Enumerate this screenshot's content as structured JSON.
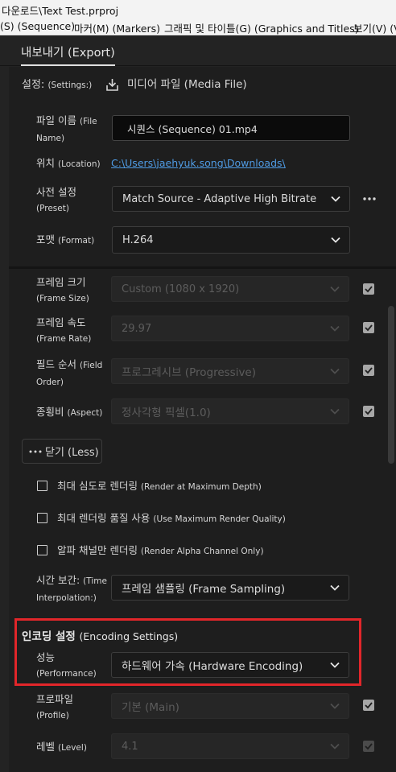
{
  "window": {
    "title": "다운로드\\Text Test.prproj"
  },
  "menu": {
    "items": [
      "(S) (Sequence)",
      "마커(M) (Markers)",
      "그래픽 및 타이틀(G) (Graphics and Titles)",
      "보기(V) (Vi"
    ]
  },
  "tab": {
    "label": "내보내기 (Export)"
  },
  "settings": {
    "heading_ko": "설정:",
    "heading_en": "(Settings:)",
    "destination": "미디어 파일 (Media File)",
    "file_name": {
      "label_ko": "파일 이름",
      "label_en": "(File Name)",
      "value": "시퀀스 (Sequence) 01.mp4"
    },
    "location": {
      "label_ko": "위치",
      "label_en": "(Location)",
      "value": "C:\\Users\\jaehyuk.song\\Downloads\\"
    },
    "preset": {
      "label_ko": "사전 설정",
      "label_en": "(Preset)",
      "value": "Match Source - Adaptive High Bitrate"
    },
    "format": {
      "label_ko": "포맷",
      "label_en": "(Format)",
      "value": "H.264"
    }
  },
  "video": {
    "frame_size": {
      "label_ko": "프레임 크기",
      "label_en": "(Frame Size)",
      "value": "Custom (1080 x 1920)",
      "checked": true
    },
    "frame_rate": {
      "label_ko": "프레임 속도",
      "label_en": "(Frame Rate)",
      "value": "29.97",
      "checked": true
    },
    "field_order": {
      "label_ko": "필드 순서",
      "label_en": "(Field Order)",
      "value": "프로그레시브 (Progressive)",
      "checked": true
    },
    "aspect": {
      "label_ko": "종횡비",
      "label_en": "(Aspect)",
      "value": "정사각형 픽셀(1.0)",
      "checked": true
    },
    "less_button": "닫기 (Less)",
    "max_depth": {
      "label_ko": "최대 심도로 렌더링",
      "label_en": "(Render at Maximum Depth)",
      "checked": false
    },
    "max_quality": {
      "label_ko": "최대 렌더링 품질 사용",
      "label_en": "(Use Maximum Render Quality)",
      "checked": false
    },
    "alpha_only": {
      "label_ko": "알파 채널만 렌더링",
      "label_en": "(Render Alpha Channel Only)",
      "checked": false
    },
    "time_interp": {
      "label_ko": "시간 보간:",
      "label_en_1": "(Time",
      "label_en_2": "Interpolation:)",
      "value": "프레임 샘플링 (Frame Sampling)"
    }
  },
  "encoding": {
    "heading_ko": "인코딩 설정",
    "heading_en": "(Encoding Settings)",
    "performance": {
      "label_ko": "성능",
      "label_en": "(Performance)",
      "value": "하드웨어 가속 (Hardware Encoding)"
    },
    "profile": {
      "label_ko": "프로파일",
      "label_en": "(Profile)",
      "value": "기본 (Main)",
      "checked": true
    },
    "level": {
      "label_ko": "레벨",
      "label_en": "(Level)",
      "value": "4.1",
      "checked": true
    }
  },
  "colors": {
    "highlight": "#e2262a",
    "link": "#4f9be4",
    "panel_bg": "#1e1e1e"
  }
}
